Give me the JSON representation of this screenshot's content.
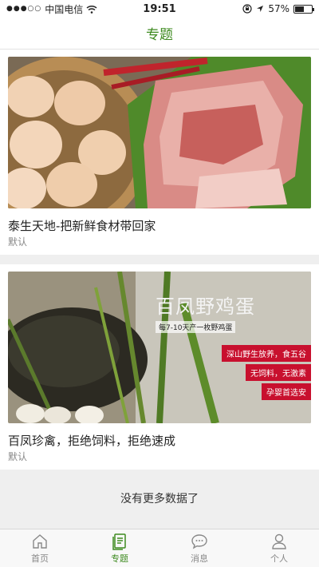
{
  "status_bar": {
    "signal": "●●●○○",
    "carrier": "中国电信",
    "time": "19:51",
    "battery_percent": "57%",
    "battery_level": 0.57
  },
  "header": {
    "title": "专题"
  },
  "topics": [
    {
      "title": "泰生天地-把新鲜食材带回家",
      "tag": "默认"
    },
    {
      "title": "百凤珍禽，拒绝饲料，拒绝速成",
      "tag": "默认",
      "image_text": {
        "headline": "百凤野鸡蛋",
        "subline": "每7-10天产一枚野鸡蛋",
        "badges": [
          "深山野生放养，食五谷",
          "无饲料，无激素",
          "孕婴首选安"
        ]
      }
    }
  ],
  "footer_message": "没有更多数据了",
  "tabs": [
    {
      "label": "首页",
      "icon": "home-icon"
    },
    {
      "label": "专题",
      "icon": "topic-document-icon",
      "active": true
    },
    {
      "label": "消息",
      "icon": "message-bubble-icon"
    },
    {
      "label": "个人",
      "icon": "person-icon"
    }
  ],
  "colors": {
    "accent": "#3d8a1f",
    "badge_red": "#c8102e"
  }
}
